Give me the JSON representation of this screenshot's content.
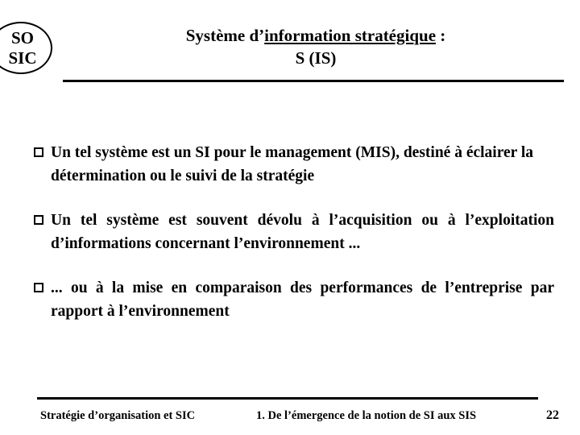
{
  "slide": {
    "logo": {
      "line1": "SO",
      "line2": "SIC"
    },
    "title": {
      "line1_prefix": "Système d’",
      "line1_underlined": "information stratégique",
      "line1_suffix": " :",
      "line2": "S (IS)"
    },
    "bullets": [
      {
        "marker": "open-square",
        "text": "Un tel système est un SI pour le management (MIS), destiné à éclairer la détermination ou le suivi de la stratégie"
      },
      {
        "marker": "open-square",
        "text": "Un tel système est souvent dévolu à l’acquisition ou à l’exploitation d’informations concernant l’environnement ..."
      },
      {
        "marker": "open-square",
        "text": "... ou à la mise en comparaison des performances de l’entreprise par rapport à l’environnement"
      }
    ],
    "footer": {
      "left": "Stratégie d’organisation et SIC",
      "center": "1. De l’émergence de la notion de SI aux SIS",
      "page_number": "22"
    }
  }
}
